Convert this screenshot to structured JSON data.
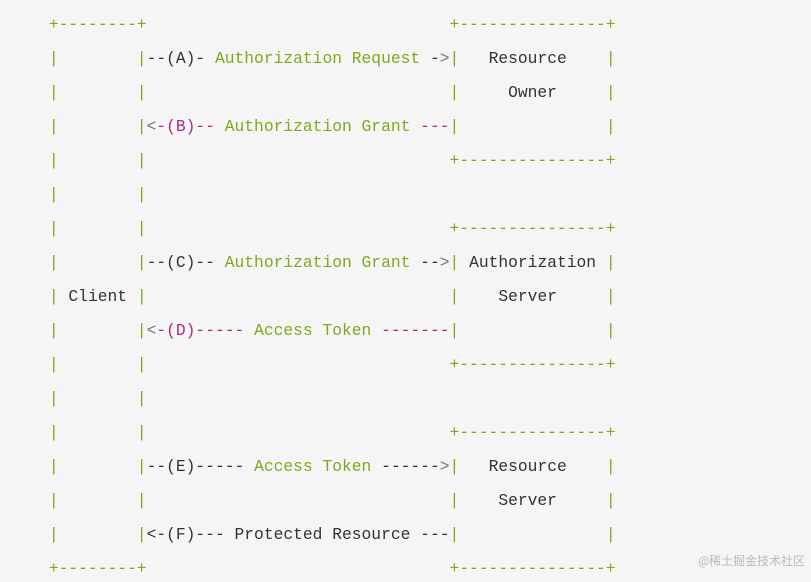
{
  "diagram": {
    "entities": {
      "client": "Client",
      "resource_owner_l1": "Resource",
      "resource_owner_l2": "Owner",
      "auth_server_l1": "Authorization",
      "auth_server_l2": "Server",
      "resource_server_l1": "Resource",
      "resource_server_l2": "Server"
    },
    "flows": {
      "a_prefix": "--(A)-",
      "a_label": "Authorization Request",
      "b_prefix": "-(B)--",
      "b_label": "Authorization Grant",
      "b_suffix": "---",
      "c_prefix": "--(C)--",
      "c_label": "Authorization Grant",
      "c_suffix": "--",
      "d_prefix": "-(D)-----",
      "d_label": "Access Token",
      "d_suffix": "-------",
      "e_prefix": "--(E)-----",
      "e_label": "Access Token",
      "e_suffix": "------",
      "f_prefix": "<-(F)---",
      "f_label": "Protected Resource",
      "f_suffix": "---"
    }
  },
  "watermark": "@稀土掘金技术社区"
}
